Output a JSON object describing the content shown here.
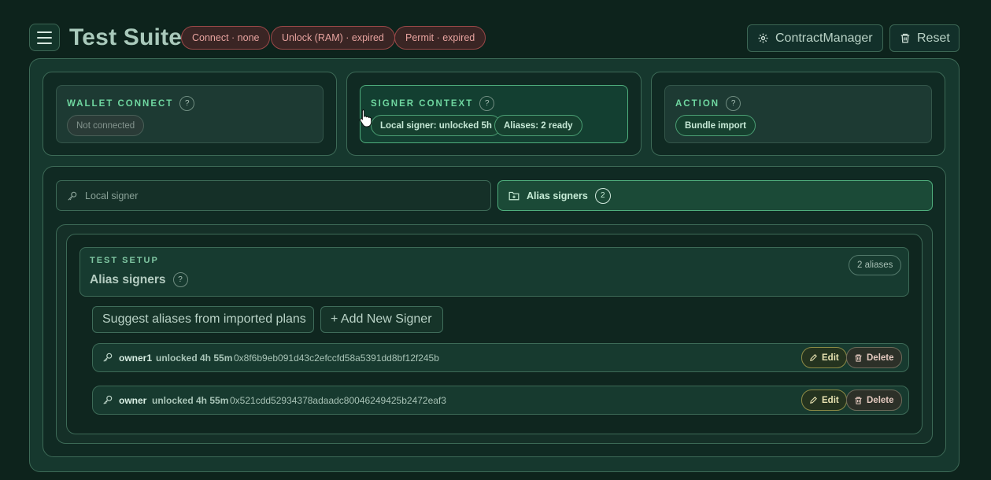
{
  "header": {
    "title": "Test Suite",
    "status_pills": [
      "Connect · none",
      "Unlock (RAM) · expired",
      "Permit · expired"
    ],
    "contract_manager_label": "ContractManager",
    "reset_label": "Reset"
  },
  "cards": {
    "wallet": {
      "title": "WALLET CONNECT",
      "chip": "Not connected"
    },
    "signer": {
      "title": "SIGNER CONTEXT",
      "chips": [
        "Local signer: unlocked 5h",
        "Aliases: 2 ready"
      ]
    },
    "action": {
      "title": "ACTION",
      "chip": "Bundle import"
    }
  },
  "help_mark": "?",
  "tabs": {
    "local": "Local signer",
    "alias": "Alias signers",
    "alias_count": "2"
  },
  "setup": {
    "eyebrow": "TEST SETUP",
    "title": "Alias signers",
    "count_label": "2 aliases",
    "suggest_label": "Suggest aliases from imported plans",
    "add_label": "+ Add New Signer"
  },
  "signers": [
    {
      "alias": "owner1",
      "state": "unlocked 4h 55m",
      "address": "0x8f6b9eb091d43c2efccfd58a5391dd8bf12f245b"
    },
    {
      "alias": "owner",
      "state": "unlocked 4h 55m",
      "address": "0x521cdd52934378adaadc80046249425b2472eaf3"
    }
  ],
  "row_actions": {
    "edit": "Edit",
    "delete": "Delete"
  }
}
